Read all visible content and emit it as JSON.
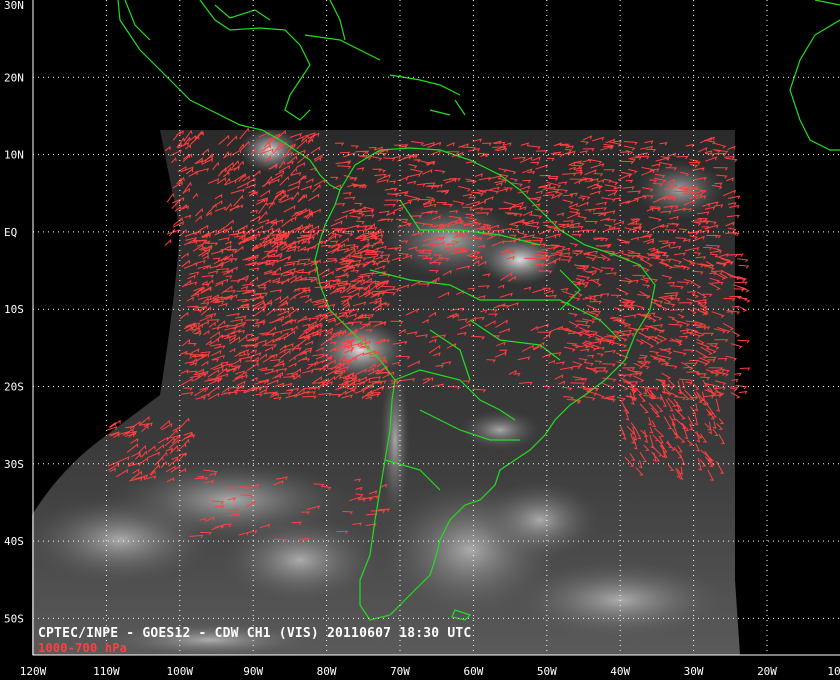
{
  "caption": {
    "main": "CPTEC/INPE - GOES12 - CDW CH1 (VIS) 20110607 18:30 UTC",
    "sub": "1000-700 hPa"
  },
  "axes": {
    "lon_labels": [
      "120W",
      "110W",
      "100W",
      "90W",
      "80W",
      "70W",
      "60W",
      "50W",
      "40W",
      "30W",
      "20W",
      "10"
    ],
    "lat_labels": [
      "30N",
      "20N",
      "10N",
      "EQ",
      "10S",
      "20S",
      "30S",
      "40S",
      "50S"
    ]
  },
  "colors": {
    "background": "#000000",
    "coastline": "#22dd22",
    "wind_vectors": "#ff4040",
    "grid": "#ffffff",
    "caption": "#ffffff",
    "pressure_label": "#ff4040"
  },
  "icons": [
    "wind-barb-icon"
  ],
  "map": {
    "projection": "cylindrical",
    "lon_range": [
      -120,
      -10
    ],
    "lat_range": [
      -55,
      30
    ],
    "grid_lines": "dotted"
  }
}
